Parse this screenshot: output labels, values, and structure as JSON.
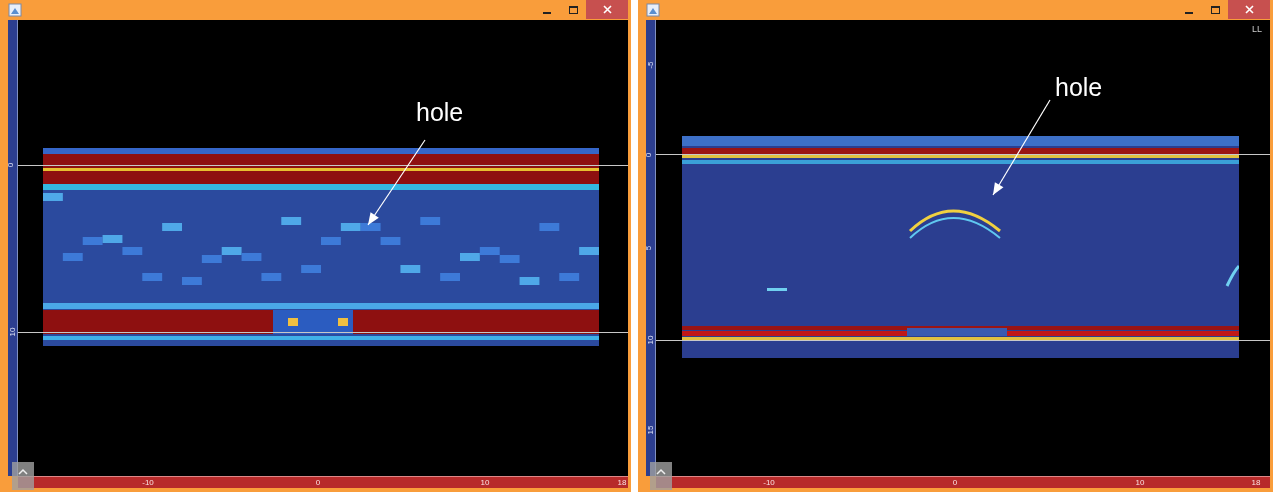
{
  "windows": [
    {
      "kind": "scan",
      "vertical_scale": [
        "0",
        "10"
      ],
      "horizontal_scale": [
        "-10",
        "0",
        "10",
        "18"
      ],
      "annotation": {
        "text": "hole"
      }
    },
    {
      "kind": "migrated",
      "corner_label": "LL",
      "vertical_scale": [
        "-5",
        "0",
        "5",
        "10",
        "15"
      ],
      "horizontal_scale": [
        "-10",
        "0",
        "10",
        "18"
      ],
      "annotation": {
        "text": "hole"
      }
    }
  ]
}
